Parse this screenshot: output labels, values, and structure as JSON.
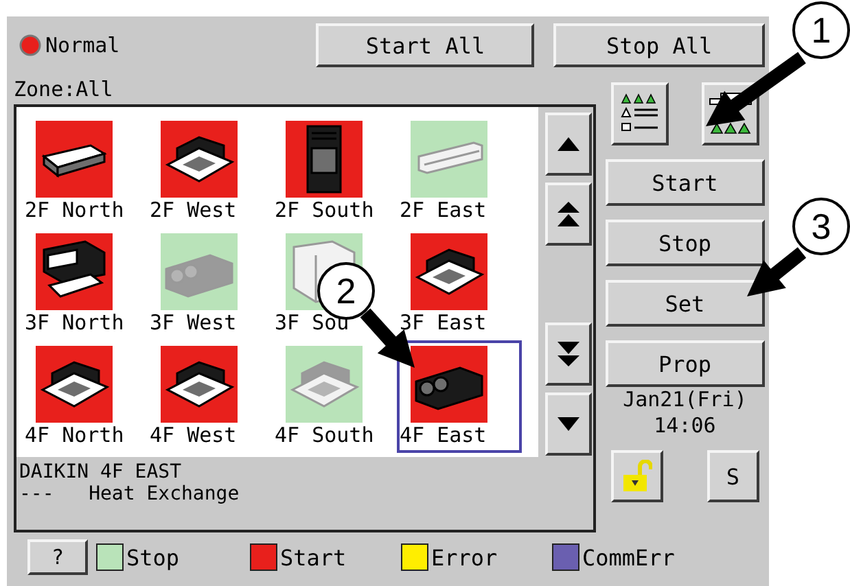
{
  "indicator": {
    "label": "Normal"
  },
  "top_buttons": [
    "Start All",
    "Stop All"
  ],
  "zone": "Zone:All",
  "units": [
    {
      "label": "2F North",
      "kind": "ceiling-suspended",
      "running": true,
      "selected": false
    },
    {
      "label": "2F West",
      "kind": "cassette",
      "running": true,
      "selected": false
    },
    {
      "label": "2F South",
      "kind": "floor-standing",
      "running": true,
      "selected": false
    },
    {
      "label": "2F East",
      "kind": "wall-mounted",
      "running": false,
      "selected": false
    },
    {
      "label": "3F North",
      "kind": "duct",
      "running": true,
      "selected": false
    },
    {
      "label": "3F West",
      "kind": "heat-exchanger",
      "running": false,
      "selected": false
    },
    {
      "label": "3F Sou",
      "kind": "cabinet",
      "running": false,
      "selected": false
    },
    {
      "label": "3F East",
      "kind": "cassette",
      "running": true,
      "selected": false
    },
    {
      "label": "4F North",
      "kind": "cassette",
      "running": true,
      "selected": false
    },
    {
      "label": "4F West",
      "kind": "cassette",
      "running": true,
      "selected": false
    },
    {
      "label": "4F South",
      "kind": "cassette",
      "running": false,
      "selected": false
    },
    {
      "label": "4F East",
      "kind": "heat-exchanger",
      "running": true,
      "selected": true
    }
  ],
  "info": [
    "DAIKIN 4F EAST",
    "---   Heat Exchange"
  ],
  "side_buttons": [
    "Start",
    "Stop",
    "Set",
    "Prop"
  ],
  "date": "Jan21(Fri)",
  "time": "14:06",
  "s_button": "S",
  "help_button": "?",
  "legend": [
    {
      "label": "Stop",
      "color": "#b9e3b9"
    },
    {
      "label": "Start",
      "color": "#e8201c"
    },
    {
      "label": "Error",
      "color": "#ffee00"
    },
    {
      "label": "CommErr",
      "color": "#6a5fb0"
    }
  ],
  "callouts": [
    "1",
    "2",
    "3"
  ]
}
